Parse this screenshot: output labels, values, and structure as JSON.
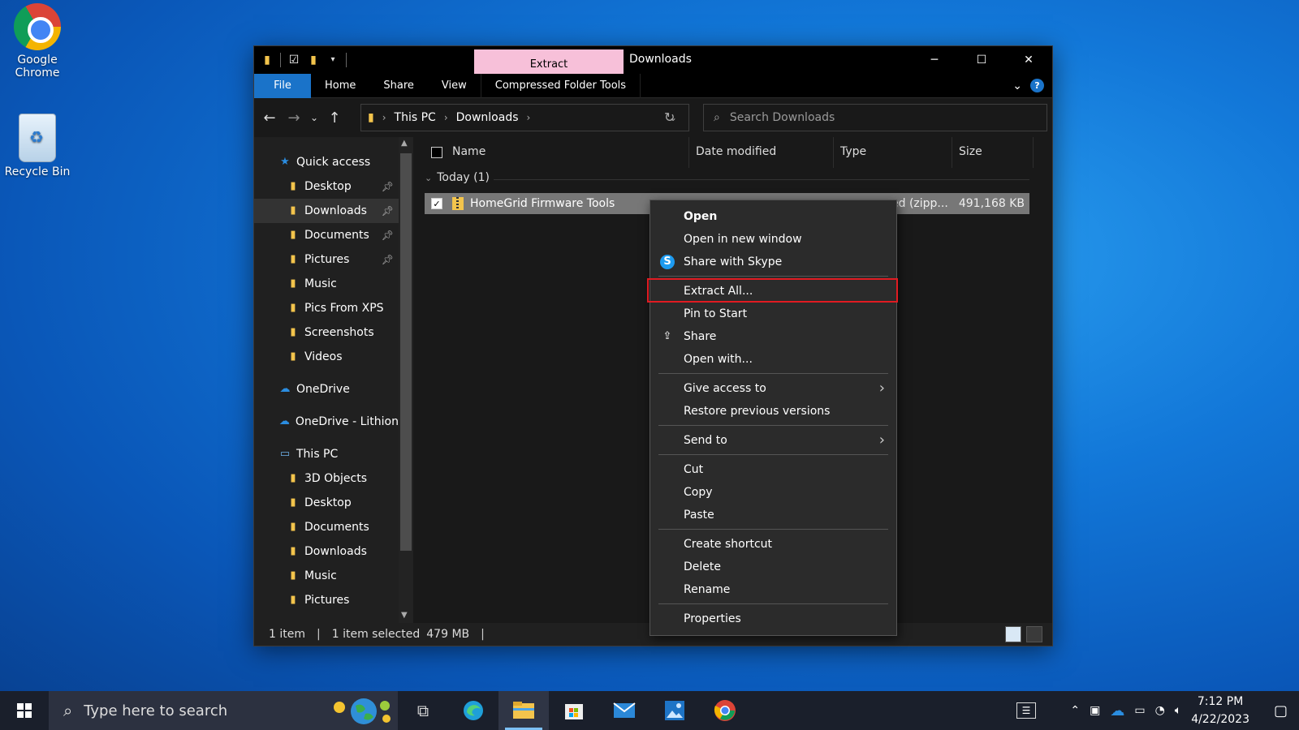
{
  "desktop": {
    "icons": [
      {
        "label_line1": "Google",
        "label_line2": "Chrome"
      },
      {
        "label_line1": "Recycle Bin"
      }
    ]
  },
  "window": {
    "title": "Downloads",
    "contextual_tab": "Extract",
    "ribbon_tabs": [
      "File",
      "Home",
      "Share",
      "View",
      "Compressed Folder Tools"
    ],
    "caption": {
      "minimize": "─",
      "maximize": "☐",
      "close": "✕"
    }
  },
  "address": {
    "crumbs": [
      "This PC",
      "Downloads"
    ]
  },
  "search": {
    "placeholder": "Search Downloads"
  },
  "nav": {
    "items": [
      {
        "label": "Quick access",
        "icon": "star-icon"
      },
      {
        "label": "Desktop",
        "icon": "folder-icon",
        "pinned": true
      },
      {
        "label": "Downloads",
        "icon": "folder-icon",
        "pinned": true,
        "selected": true
      },
      {
        "label": "Documents",
        "icon": "folder-icon",
        "pinned": true
      },
      {
        "label": "Pictures",
        "icon": "folder-icon",
        "pinned": true
      },
      {
        "label": "Music",
        "icon": "folder-icon"
      },
      {
        "label": "Pics From XPS",
        "icon": "folder-icon"
      },
      {
        "label": "Screenshots",
        "icon": "folder-icon"
      },
      {
        "label": "Videos",
        "icon": "folder-icon"
      },
      {
        "label": "OneDrive",
        "icon": "cloud-icon"
      },
      {
        "label": "OneDrive - Lithion",
        "icon": "cloud-icon"
      },
      {
        "label": "This PC",
        "icon": "computer-icon"
      },
      {
        "label": "3D Objects",
        "icon": "folder-icon"
      },
      {
        "label": "Desktop",
        "icon": "folder-icon"
      },
      {
        "label": "Documents",
        "icon": "folder-icon"
      },
      {
        "label": "Downloads",
        "icon": "folder-icon"
      },
      {
        "label": "Music",
        "icon": "folder-icon"
      },
      {
        "label": "Pictures",
        "icon": "folder-icon"
      }
    ]
  },
  "columns": {
    "name": "Name",
    "date": "Date modified",
    "type": "Type",
    "size": "Size"
  },
  "group": {
    "label": "Today (1)"
  },
  "file": {
    "name": "HomeGrid Firmware Tools",
    "type": "ed (zipp...",
    "size": "491,168 KB"
  },
  "status": {
    "count": "1 item",
    "selected": "1 item selected",
    "size": "479 MB"
  },
  "context_menu": {
    "items": [
      {
        "label": "Open"
      },
      {
        "label": "Open in new window"
      },
      {
        "label": "Share with Skype"
      },
      {
        "label": "Extract All..."
      },
      {
        "label": "Pin to Start"
      },
      {
        "label": "Share"
      },
      {
        "label": "Open with..."
      },
      {
        "label": "Give access to"
      },
      {
        "label": "Restore previous versions"
      },
      {
        "label": "Send to"
      },
      {
        "label": "Cut"
      },
      {
        "label": "Copy"
      },
      {
        "label": "Paste"
      },
      {
        "label": "Create shortcut"
      },
      {
        "label": "Delete"
      },
      {
        "label": "Rename"
      },
      {
        "label": "Properties"
      }
    ],
    "highlight_color": "#e11b22"
  },
  "taskbar": {
    "search_placeholder": "Type here to search",
    "time": "7:12 PM",
    "date": "4/22/2023"
  }
}
